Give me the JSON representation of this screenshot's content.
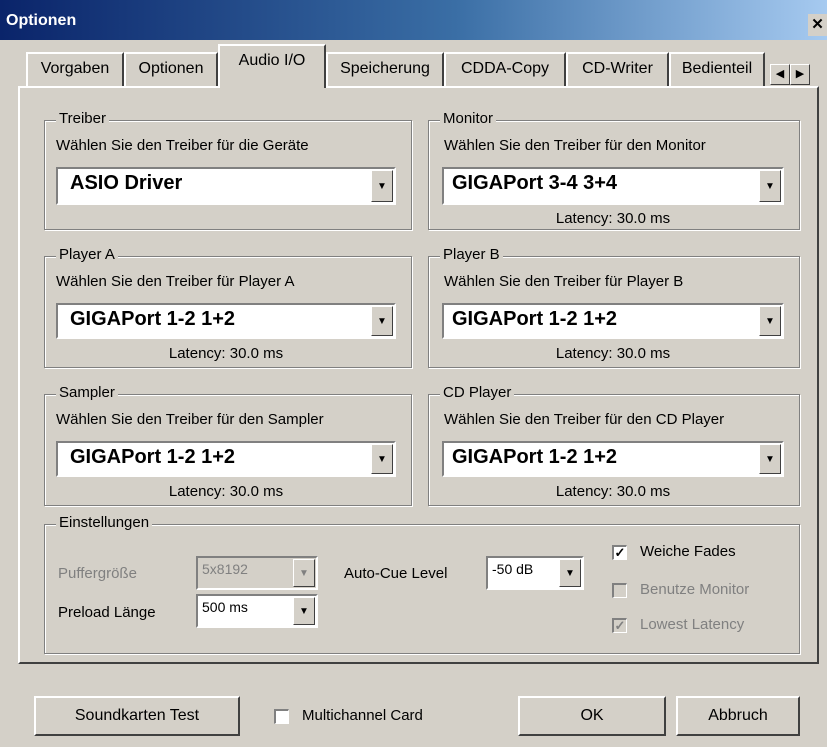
{
  "window": {
    "title": "Optionen",
    "close_glyph": "✕"
  },
  "tabs": [
    {
      "label": "Vorgaben"
    },
    {
      "label": "Optionen"
    },
    {
      "label": "Audio I/O",
      "active": true
    },
    {
      "label": "Speicherung"
    },
    {
      "label": "CDDA-Copy"
    },
    {
      "label": "CD-Writer"
    },
    {
      "label": "Bedienteil"
    }
  ],
  "tab_scroll": {
    "left_icon": "◀",
    "right_icon": "▶"
  },
  "groups": {
    "treiber": {
      "title": "Treiber",
      "label": "Wählen Sie den Treiber für die Geräte",
      "value": "ASIO Driver"
    },
    "monitor": {
      "title": "Monitor",
      "label": "Wählen Sie den Treiber für den Monitor",
      "value": "GIGAPort 3-4 3+4",
      "latency": "Latency: 30.0 ms"
    },
    "player_a": {
      "title": "Player A",
      "label": "Wählen Sie den Treiber für Player A",
      "value": "GIGAPort 1-2 1+2",
      "latency": "Latency: 30.0 ms"
    },
    "player_b": {
      "title": "Player B",
      "label": "Wählen Sie den Treiber für Player B",
      "value": "GIGAPort 1-2 1+2",
      "latency": "Latency: 30.0 ms"
    },
    "sampler": {
      "title": "Sampler",
      "label": "Wählen Sie den Treiber für den Sampler",
      "value": "GIGAPort 1-2 1+2",
      "latency": "Latency: 30.0 ms"
    },
    "cd_player": {
      "title": "CD Player",
      "label": "Wählen Sie den Treiber für den CD Player",
      "value": "GIGAPort 1-2 1+2",
      "latency": "Latency: 30.0 ms"
    }
  },
  "einstellungen": {
    "title": "Einstellungen",
    "puffergroesse_label": "Puffergröße",
    "puffergroesse_value": "5x8192",
    "preload_label": "Preload Länge",
    "preload_value": "500 ms",
    "autocue_label": "Auto-Cue Level",
    "autocue_value": "-50 dB",
    "weiche_fades_label": "Weiche Fades",
    "weiche_fades_checked": true,
    "benutze_monitor_label": "Benutze Monitor",
    "benutze_monitor_checked": false,
    "lowest_latency_label": "Lowest Latency",
    "lowest_latency_checked": true
  },
  "footer": {
    "soundkarten_test": "Soundkarten Test",
    "multichannel_label": "Multichannel Card",
    "multichannel_checked": false,
    "ok": "OK",
    "abbruch": "Abbruch"
  },
  "glyphs": {
    "dropdown_arrow": "▼",
    "check": "✓"
  }
}
